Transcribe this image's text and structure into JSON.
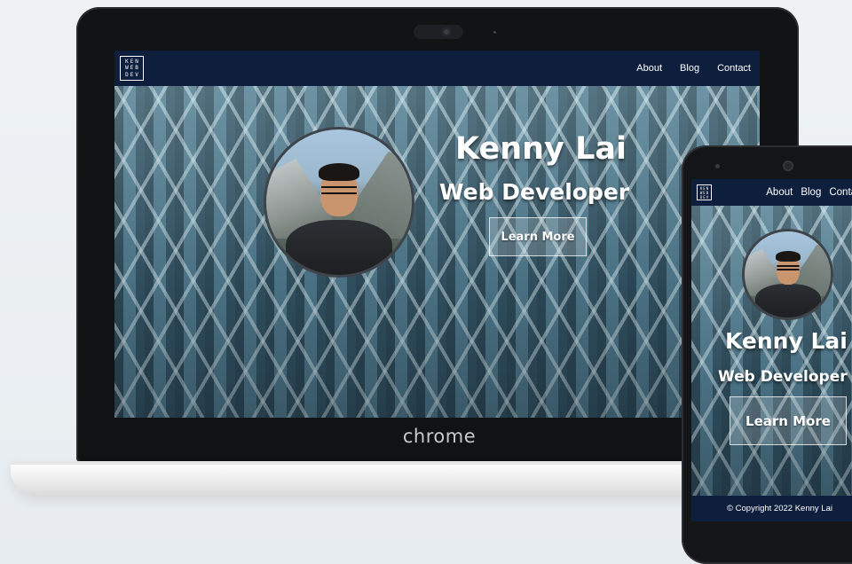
{
  "laptop": {
    "brand_text": "chrome",
    "site": {
      "logo_lines": [
        "KEN",
        "WEB",
        "DEV"
      ],
      "nav_links": [
        "About",
        "Blog",
        "Contact"
      ],
      "hero_name": "Kenny Lai",
      "hero_role": "Web Developer",
      "cta_label": "Learn More"
    }
  },
  "phone": {
    "site": {
      "logo_lines": [
        "KEN",
        "WEB",
        "DEV"
      ],
      "nav_links": [
        "About",
        "Blog",
        "Contact"
      ],
      "hero_name": "Kenny Lai",
      "hero_role": "Web Developer",
      "cta_label": "Learn More",
      "footer_text": "© Copyright 2022 Kenny Lai"
    }
  },
  "colors": {
    "nav_background": "#0e1f3e",
    "text": "#ffffff",
    "device_frame": "#111214",
    "laptop_base": "#f3f3f3",
    "page_background": "#eef2f5"
  }
}
